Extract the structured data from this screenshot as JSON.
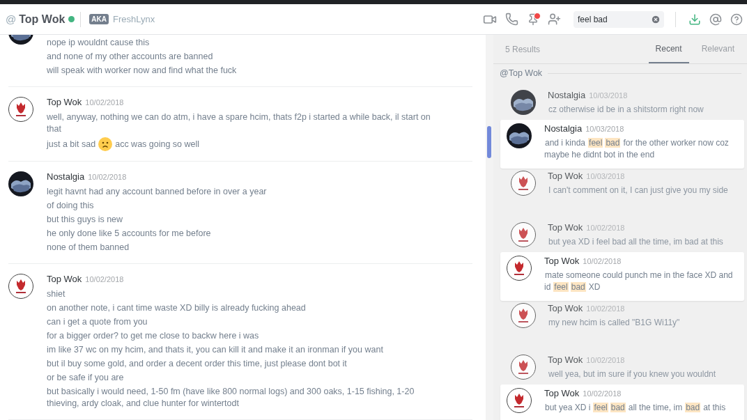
{
  "header": {
    "at_sign": "@",
    "title": "Top Wok",
    "online": true,
    "aka_badge": "AKA",
    "aka_name": "FreshLynx",
    "pin_notification": true,
    "search": {
      "value": "feel bad"
    }
  },
  "chat": [
    {
      "avatar": {
        "kind": "landscape"
      },
      "lines": [
        {
          "kind": "text",
          "text": "nope ip wouldnt cause this"
        },
        {
          "kind": "text",
          "text": "and none of my other accounts are banned"
        },
        {
          "kind": "text",
          "text": "will speak with worker now and find what the fuck"
        }
      ]
    },
    {
      "avatar": {
        "kind": "flame"
      },
      "author": "Top Wok",
      "date": "10/02/2018",
      "lines": [
        {
          "kind": "text",
          "text": "well, anyway, nothing we can do atm, i have a spare hcim, thats f2p i started a while back, il start on that"
        },
        {
          "kind": "frowning_emoji",
          "text": "just a bit sad",
          "text_after": "acc was going so well"
        }
      ]
    },
    {
      "avatar": {
        "kind": "landscape"
      },
      "author": "Nostalgia",
      "date": "10/02/2018",
      "lines": [
        {
          "kind": "text",
          "text": "legit havnt had any account banned before in over a year"
        },
        {
          "kind": "text",
          "text": "of doing this"
        },
        {
          "kind": "text",
          "text": "but this guys is new"
        },
        {
          "kind": "text",
          "text": "he only done like 5 accounts for me before"
        },
        {
          "kind": "text",
          "text": "none of them banned"
        }
      ]
    },
    {
      "avatar": {
        "kind": "flame"
      },
      "author": "Top Wok",
      "date": "10/02/2018",
      "lines": [
        {
          "kind": "text",
          "text": "shiet"
        },
        {
          "kind": "text",
          "text": "on another note, i cant time waste XD billy is already fucking ahead"
        },
        {
          "kind": "text",
          "text": "can i get a quote from you"
        },
        {
          "kind": "text",
          "text": "for a bigger order? to get me close to backw here i was"
        },
        {
          "kind": "text",
          "text": "im like 37 wc on my hcim, and thats it, you can kill it and make it an ironman if you want"
        },
        {
          "kind": "text",
          "text": "but il buy some gold, and order a decent order this time, just please dont bot it"
        },
        {
          "kind": "text",
          "text": "or be safe if you are"
        },
        {
          "kind": "text",
          "text": "but basically i would need, 1-50 fm (have like 800 normal logs) and 300 oaks, 1-15 fishing, 1-20 thieving, ardy cloak, and clue hunter for wintertodt"
        }
      ]
    }
  ],
  "search_results": {
    "count": "5 Results",
    "tabs": [
      {
        "label": "Recent",
        "selected": true
      },
      {
        "label": "Relevant",
        "selected": false
      }
    ],
    "channel": "@Top Wok",
    "groups": [
      [
        {
          "kind": "context",
          "avatar": {
            "kind": "landscape"
          },
          "author": "Nostalgia",
          "date": "10/03/2018",
          "segments": [
            {
              "text": "cz otherwise id be in a shitstorm right now",
              "highlighted": false
            }
          ]
        },
        {
          "kind": "hit",
          "avatar": {
            "kind": "landscape"
          },
          "author": "Nostalgia",
          "date": "10/03/2018",
          "segments": [
            {
              "text": "and i kinda",
              "highlighted": false
            },
            {
              "text": "feel",
              "highlighted": true
            },
            {
              "text": "bad",
              "highlighted": true
            },
            {
              "text": "for the other worker now coz maybe he didnt bot in the end",
              "highlighted": false
            }
          ]
        },
        {
          "kind": "context",
          "avatar": {
            "kind": "flame"
          },
          "author": "Top Wok",
          "date": "10/03/2018",
          "segments": [
            {
              "text": "I can't comment on it, I can just give you my side",
              "highlighted": false
            }
          ]
        }
      ],
      [
        {
          "kind": "context",
          "avatar": {
            "kind": "flame"
          },
          "author": "Top Wok",
          "date": "10/02/2018",
          "segments": [
            {
              "text": "but yea XD i feel bad all the time, im bad at this",
              "highlighted": false
            }
          ]
        },
        {
          "kind": "hit",
          "avatar": {
            "kind": "flame"
          },
          "author": "Top Wok",
          "date": "10/02/2018",
          "segments": [
            {
              "text": "mate someone could punch me in the face XD and id",
              "highlighted": false
            },
            {
              "text": "feel",
              "highlighted": true
            },
            {
              "text": "bad",
              "highlighted": true
            },
            {
              "text": "XD",
              "highlighted": false
            }
          ]
        },
        {
          "kind": "context",
          "avatar": {
            "kind": "flame"
          },
          "author": "Top Wok",
          "date": "10/02/2018",
          "segments": [
            {
              "text": "my new hcim is called \"B1G Wi11y\"",
              "highlighted": false
            }
          ]
        }
      ],
      [
        {
          "kind": "context",
          "avatar": {
            "kind": "flame"
          },
          "author": "Top Wok",
          "date": "10/02/2018",
          "segments": [
            {
              "text": "well yea, but im sure if you knew you wouldnt",
              "highlighted": false
            }
          ]
        },
        {
          "kind": "hit",
          "avatar": {
            "kind": "flame"
          },
          "author": "Top Wok",
          "date": "10/02/2018",
          "segments": [
            {
              "text": "but yea XD i",
              "highlighted": false
            },
            {
              "text": "feel",
              "highlighted": true
            },
            {
              "text": "bad",
              "highlighted": true
            },
            {
              "text": "all the time, im",
              "highlighted": false
            },
            {
              "text": "bad",
              "highlighted": true
            },
            {
              "text": "at this",
              "highlighted": false
            }
          ]
        }
      ]
    ]
  }
}
